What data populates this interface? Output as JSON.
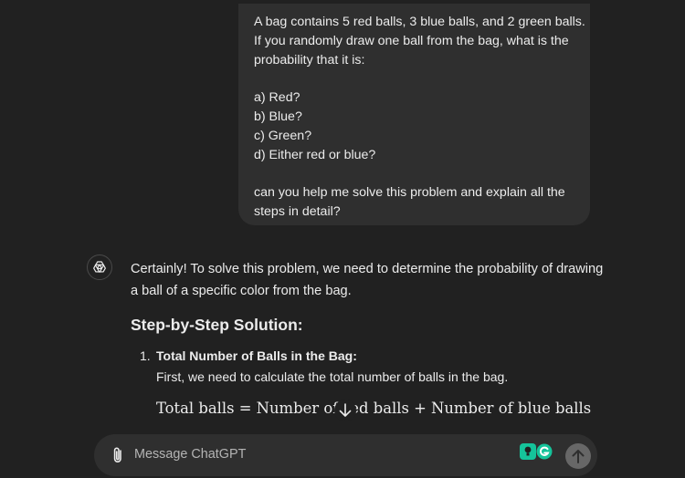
{
  "user_message": {
    "lines": [
      "A bag contains 5 red balls, 3 blue balls, and 2 green balls.",
      "If you randomly draw one ball from the bag, what is the",
      "probability that it is:",
      "",
      "a) Red?",
      "b) Blue?",
      "c) Green?",
      "d) Either red or blue?",
      "",
      "can you help me solve this problem and explain all the",
      "steps in detail?"
    ]
  },
  "assistant": {
    "intro_line1": "Certainly! To solve this problem, we need to determine the probability of drawing",
    "intro_line2": "a ball of a specific color from the bag.",
    "heading": "Step-by-Step Solution:",
    "step1": {
      "number": "1.",
      "title": "Total Number of Balls in the Bag:",
      "description": "First, we need to calculate the total number of balls in the bag."
    },
    "math_line": "Total balls = Number of red balls + Number of blue balls + Number of green balls"
  },
  "composer": {
    "placeholder": "Message ChatGPT"
  },
  "colors": {
    "background": "#212121",
    "bubble": "#2f2f2f",
    "grammarly_green": "#15c39a",
    "send_button": "#676767"
  }
}
